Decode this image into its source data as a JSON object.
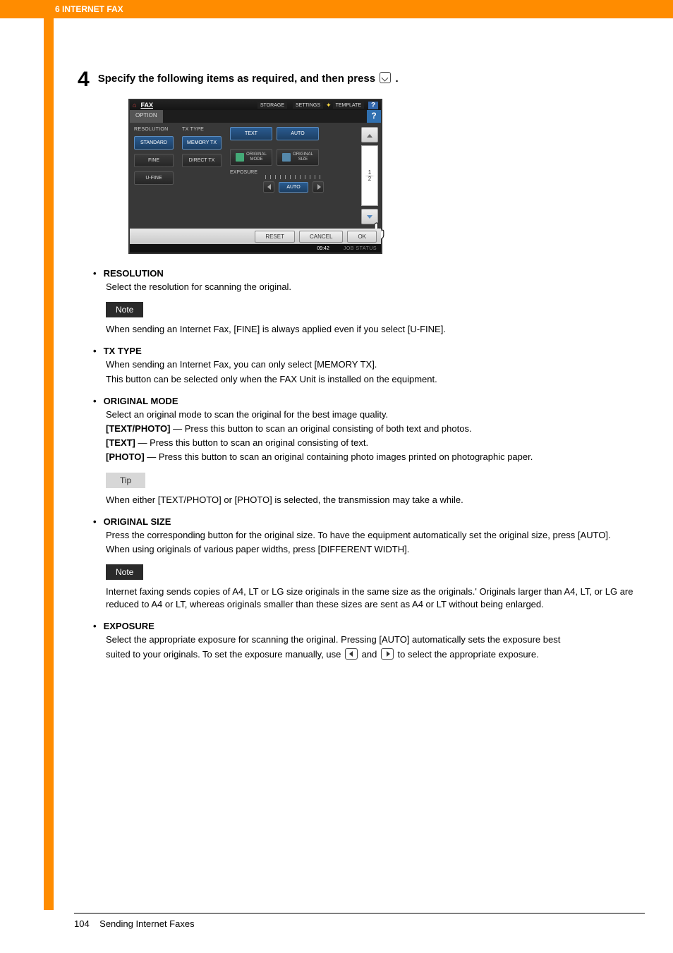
{
  "header": {
    "chapter": "6 INTERNET FAX"
  },
  "step": {
    "number": "4",
    "text_before": "Specify the following items as required, and then press ",
    "text_after": "."
  },
  "screenshot": {
    "title": "FAX",
    "topTabs": [
      "STORAGE",
      "SETTINGS",
      "TEMPLATE"
    ],
    "optionTab": "OPTION",
    "help": "?",
    "resolution": {
      "label": "RESOLUTION",
      "buttons": [
        "STANDARD",
        "FINE",
        "U-FINE"
      ],
      "selected": "STANDARD"
    },
    "txtype": {
      "label": "TX TYPE",
      "buttons": [
        "MEMORY TX",
        "DIRECT TX"
      ],
      "selected": "MEMORY TX"
    },
    "topRow": {
      "text": "TEXT",
      "auto": "AUTO"
    },
    "cards": {
      "originalMode": "ORIGINAL\nMODE",
      "originalSize": "ORIGINAL\nSIZE"
    },
    "exposure": {
      "label": "EXPOSURE",
      "auto": "AUTO"
    },
    "pager": {
      "cur": "1",
      "total": "2"
    },
    "footer": {
      "reset": "RESET",
      "cancel": "CANCEL",
      "ok": "OK"
    },
    "status": {
      "time": "09:42",
      "job": "JOB STATUS"
    }
  },
  "bullets": {
    "resolution": {
      "title": "RESOLUTION",
      "body": "Select the resolution for scanning the original.",
      "noteLabel": "Note",
      "note": "When sending an Internet Fax, [FINE] is always applied even if you select [U-FINE]."
    },
    "txtype": {
      "title": "TX TYPE",
      "line1": "When sending an Internet Fax, you can only select [MEMORY TX].",
      "line2": "This button can be selected only when the FAX Unit is installed on the equipment."
    },
    "originalMode": {
      "title": "ORIGINAL MODE",
      "line1": "Select an original mode to scan the original for the best image quality.",
      "tp_label": "[TEXT/PHOTO]",
      "tp_text": " — Press this button to scan an original consisting of both text and photos.",
      "t_label": "[TEXT]",
      "t_text": " — Press this button to scan an original consisting of text.",
      "p_label": "[PHOTO]",
      "p_text": " — Press this button to scan an original containing photo images printed on photographic paper.",
      "tipLabel": "Tip",
      "tip": "When either [TEXT/PHOTO] or [PHOTO] is selected, the transmission may take a while."
    },
    "originalSize": {
      "title": "ORIGINAL SIZE",
      "line1": "Press the corresponding button for the original size. To have the equipment automatically set the original size, press [AUTO].",
      "line2": "When using originals of various paper widths, press [DIFFERENT WIDTH].",
      "noteLabel": "Note",
      "note": "Internet faxing sends copies of A4, LT or LG size originals in the same size as the originals.' Originals larger than A4, LT, or LG are reduced to A4 or LT, whereas originals smaller than these sizes are sent as A4 or LT without being enlarged."
    },
    "exposure": {
      "title": "EXPOSURE",
      "line1": "Select the appropriate exposure for scanning the original. Pressing [AUTO] automatically sets the exposure best",
      "line2_pre": "suited to your originals. To set the exposure manually, use ",
      "line2_mid": " and ",
      "line2_post": " to select the appropriate exposure."
    }
  },
  "footer": {
    "pageNum": "104",
    "title": "Sending Internet Faxes"
  }
}
